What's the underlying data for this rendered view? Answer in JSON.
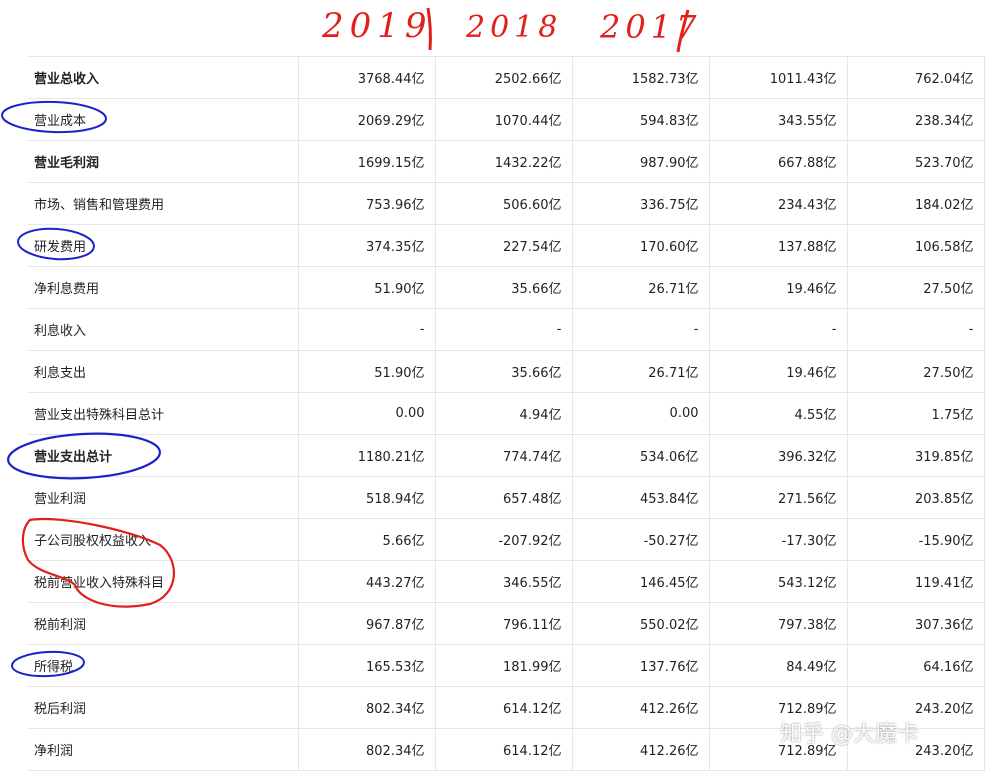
{
  "handwritten_years": [
    "2019",
    "2018",
    "2017"
  ],
  "rows": [
    {
      "label": "营业总收入",
      "bold": true,
      "values": [
        "3768.44亿",
        "2502.66亿",
        "1582.73亿",
        "1011.43亿",
        "762.04亿"
      ]
    },
    {
      "label": "营业成本",
      "bold": false,
      "values": [
        "2069.29亿",
        "1070.44亿",
        "594.83亿",
        "343.55亿",
        "238.34亿"
      ]
    },
    {
      "label": "营业毛利润",
      "bold": true,
      "values": [
        "1699.15亿",
        "1432.22亿",
        "987.90亿",
        "667.88亿",
        "523.70亿"
      ]
    },
    {
      "label": "市场、销售和管理费用",
      "bold": false,
      "values": [
        "753.96亿",
        "506.60亿",
        "336.75亿",
        "234.43亿",
        "184.02亿"
      ]
    },
    {
      "label": "研发费用",
      "bold": false,
      "values": [
        "374.35亿",
        "227.54亿",
        "170.60亿",
        "137.88亿",
        "106.58亿"
      ]
    },
    {
      "label": "净利息费用",
      "bold": false,
      "values": [
        "51.90亿",
        "35.66亿",
        "26.71亿",
        "19.46亿",
        "27.50亿"
      ]
    },
    {
      "label": "利息收入",
      "bold": false,
      "values": [
        "-",
        "-",
        "-",
        "-",
        "-"
      ]
    },
    {
      "label": "利息支出",
      "bold": false,
      "values": [
        "51.90亿",
        "35.66亿",
        "26.71亿",
        "19.46亿",
        "27.50亿"
      ]
    },
    {
      "label": "营业支出特殊科目总计",
      "bold": false,
      "values": [
        "0.00",
        "4.94亿",
        "0.00",
        "4.55亿",
        "1.75亿"
      ]
    },
    {
      "label": "营业支出总计",
      "bold": true,
      "values": [
        "1180.21亿",
        "774.74亿",
        "534.06亿",
        "396.32亿",
        "319.85亿"
      ]
    },
    {
      "label": "营业利润",
      "bold": false,
      "values": [
        "518.94亿",
        "657.48亿",
        "453.84亿",
        "271.56亿",
        "203.85亿"
      ]
    },
    {
      "label": "子公司股权权益收入",
      "bold": false,
      "values": [
        "5.66亿",
        "-207.92亿",
        "-50.27亿",
        "-17.30亿",
        "-15.90亿"
      ]
    },
    {
      "label": "税前营业收入特殊科目",
      "bold": false,
      "values": [
        "443.27亿",
        "346.55亿",
        "146.45亿",
        "543.12亿",
        "119.41亿"
      ]
    },
    {
      "label": "税前利润",
      "bold": false,
      "values": [
        "967.87亿",
        "796.11亿",
        "550.02亿",
        "797.38亿",
        "307.36亿"
      ]
    },
    {
      "label": "所得税",
      "bold": false,
      "values": [
        "165.53亿",
        "181.99亿",
        "137.76亿",
        "84.49亿",
        "64.16亿"
      ]
    },
    {
      "label": "税后利润",
      "bold": false,
      "values": [
        "802.34亿",
        "614.12亿",
        "412.26亿",
        "712.89亿",
        "243.20亿"
      ]
    },
    {
      "label": "净利润",
      "bold": false,
      "values": [
        "802.34亿",
        "614.12亿",
        "412.26亿",
        "712.89亿",
        "243.20亿"
      ]
    }
  ],
  "watermark": "知乎 @大魔卡",
  "colors": {
    "ink_red": "#e0201b",
    "ink_blue": "#1a23c9",
    "grid": "#e6e6e6"
  }
}
